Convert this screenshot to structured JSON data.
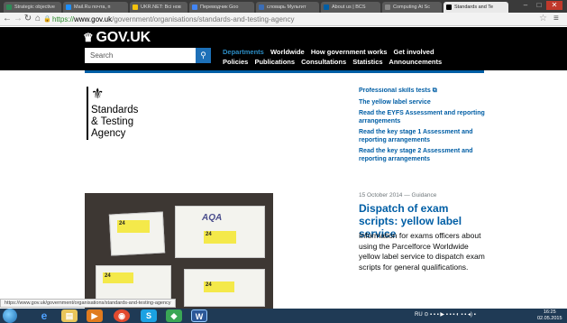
{
  "browser": {
    "tabs": [
      {
        "label": "Strategic objective",
        "color": "#2e8b57"
      },
      {
        "label": "Mail.Ru почта, п",
        "color": "#1e90ff"
      },
      {
        "label": "UKR.NET: Всі нов",
        "color": "#f4c20d"
      },
      {
        "label": "Переводчик Goo",
        "color": "#4285f4"
      },
      {
        "label": "словарь Мультит",
        "color": "#3b6db5"
      },
      {
        "label": "About us | BCS",
        "color": "#005ea5"
      },
      {
        "label": "Computing At Sc",
        "color": "#888888"
      },
      {
        "label": "Standards and Te",
        "color": "#000000"
      }
    ],
    "url_prefix": "https://",
    "url_host": "www.gov.uk",
    "url_path": "/government/organisations/standards-and-testing-agency",
    "status_url": "https://www.gov.uk/government/organisations/standards-and-testing-agency"
  },
  "header": {
    "logo": "GOV.UK",
    "search_placeholder": "Search",
    "nav_row1": [
      "Departments",
      "Worldwide",
      "How government works",
      "Get involved"
    ],
    "nav_row2": [
      "Policies",
      "Publications",
      "Consultations",
      "Statistics",
      "Announcements"
    ]
  },
  "org": {
    "name_line1": "Standards",
    "name_line2": "& Testing",
    "name_line3": "Agency"
  },
  "sidelinks": [
    "Professional skills tests",
    "The yellow label service",
    "Read the EYFS Assessment and reporting arrangements",
    "Read the key stage 1 Assessment and reporting arrangements",
    "Read the key stage 2 Assessment and reporting arrangements"
  ],
  "featured": {
    "meta": "15 October 2014 — Guidance",
    "title": "Dispatch of exam scripts: yellow label service",
    "description": "Information for exams officers about using the Parcelforce Worldwide yellow label service to dispatch exam scripts for general qualifications.",
    "image_labels": [
      "24",
      "24",
      "24",
      "24"
    ],
    "image_brand": "AQA"
  },
  "taskbar": {
    "tray_lang": "RU",
    "time": "16:25",
    "date": "02.05.2015"
  },
  "colors": {
    "brand_blue": "#005ea5",
    "link_blue": "#2b8cc4",
    "header_bg": "#000000"
  }
}
